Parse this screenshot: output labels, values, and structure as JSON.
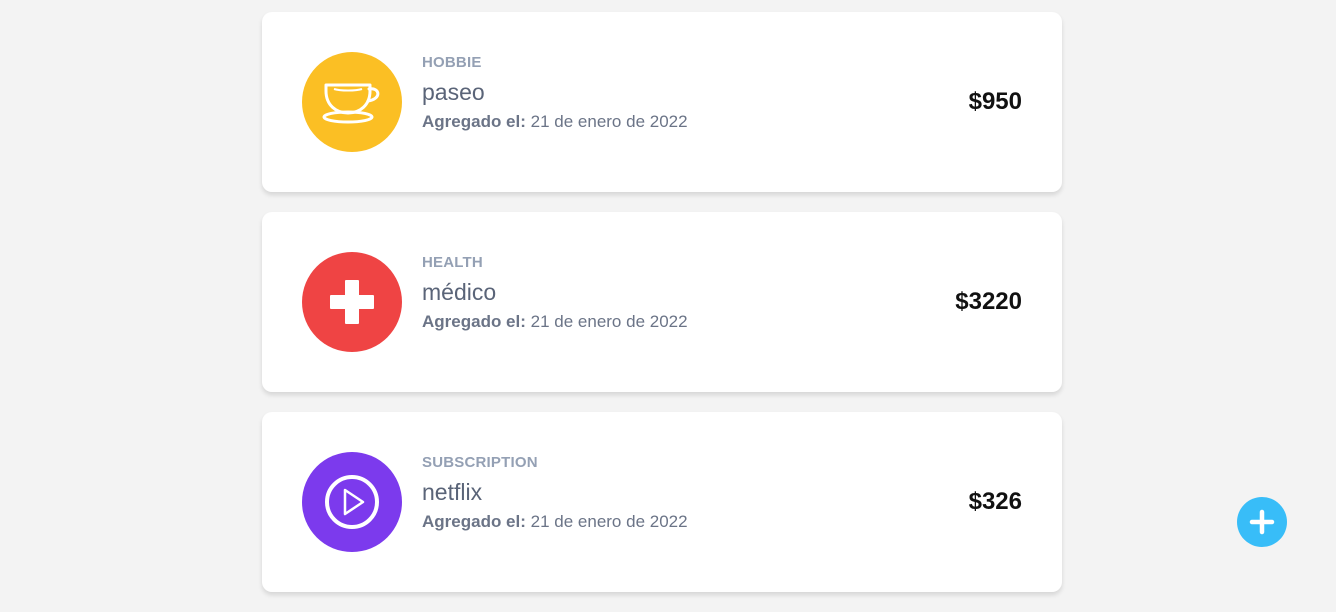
{
  "expenses": [
    {
      "category": "HOBBIE",
      "name": "paseo",
      "date_label": "Agregado el:",
      "date": "21 de enero de 2022",
      "amount": "$950",
      "icon": "coffee-cup-icon",
      "color": "#fbbf24"
    },
    {
      "category": "HEALTH",
      "name": "médico",
      "date_label": "Agregado el:",
      "date": "21 de enero de 2022",
      "amount": "$3220",
      "icon": "medical-cross-icon",
      "color": "#ef4444"
    },
    {
      "category": "SUBSCRIPTION",
      "name": "netflix",
      "date_label": "Agregado el:",
      "date": "21 de enero de 2022",
      "amount": "$326",
      "icon": "play-circle-icon",
      "color": "#7c3aed"
    }
  ],
  "fab": {
    "icon": "plus-icon",
    "color": "#38bdf8"
  }
}
